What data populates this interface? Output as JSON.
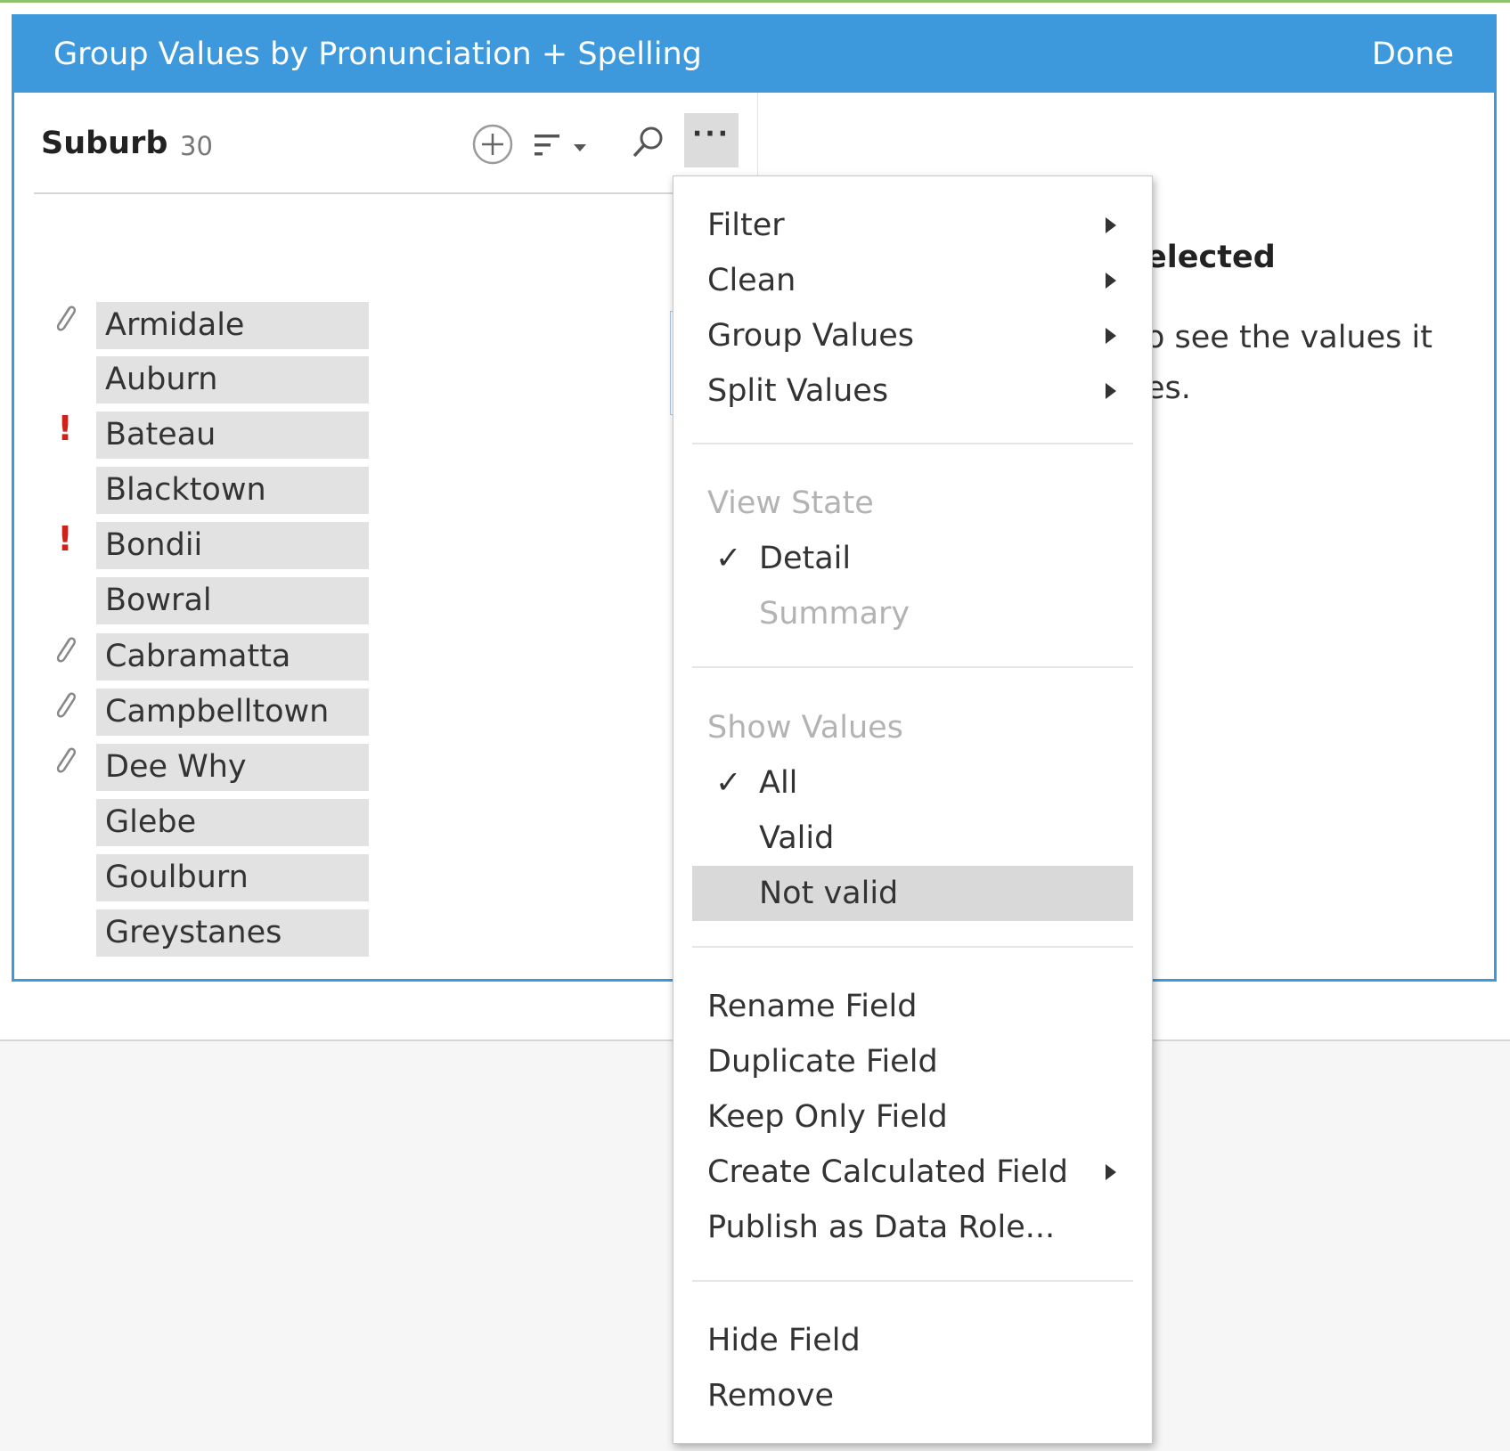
{
  "dialog": {
    "title": "Group Values by Pronunciation + Spelling",
    "done_label": "Done"
  },
  "field": {
    "name": "Suburb",
    "count": "30"
  },
  "toolbar": {
    "add_icon": "plus-circle-icon",
    "sort_icon": "sort-icon",
    "sort_caret_icon": "chevron-down-icon",
    "search_icon": "search-icon",
    "more_label": "···"
  },
  "values": [
    {
      "label": "Armidale",
      "icon": "paperclip"
    },
    {
      "label": "Auburn",
      "icon": ""
    },
    {
      "label": "Bateau",
      "icon": "!"
    },
    {
      "label": "Blacktown",
      "icon": ""
    },
    {
      "label": "Bondii",
      "icon": "!"
    },
    {
      "label": "Bowral",
      "icon": ""
    },
    {
      "label": "Cabramatta",
      "icon": "paperclip"
    },
    {
      "label": "Campbelltown",
      "icon": "paperclip"
    },
    {
      "label": "Dee Why",
      "icon": "paperclip"
    },
    {
      "label": "Glebe",
      "icon": ""
    },
    {
      "label": "Goulburn",
      "icon": ""
    },
    {
      "label": "Greystanes",
      "icon": ""
    }
  ],
  "right_panel": {
    "heading": "elected",
    "line1": "o see the values it",
    "line2": "es."
  },
  "menu": {
    "filter": "Filter",
    "clean": "Clean",
    "group_values": "Group Values",
    "split_values": "Split Values",
    "view_state_header": "View State",
    "detail": "Detail",
    "summary": "Summary",
    "show_values_header": "Show Values",
    "all": "All",
    "valid": "Valid",
    "not_valid": "Not valid",
    "rename_field": "Rename Field",
    "duplicate_field": "Duplicate Field",
    "keep_only_field": "Keep Only Field",
    "create_calculated_field": "Create Calculated Field",
    "publish_as_data_role": "Publish as Data Role...",
    "hide_field": "Hide Field",
    "remove": "Remove",
    "check_mark": "✓"
  },
  "colors": {
    "header_blue": "#3d99dc",
    "warning_red": "#d0201a",
    "row_gray": "#e2e2e2",
    "highlight_gray": "#d9d9d9"
  }
}
